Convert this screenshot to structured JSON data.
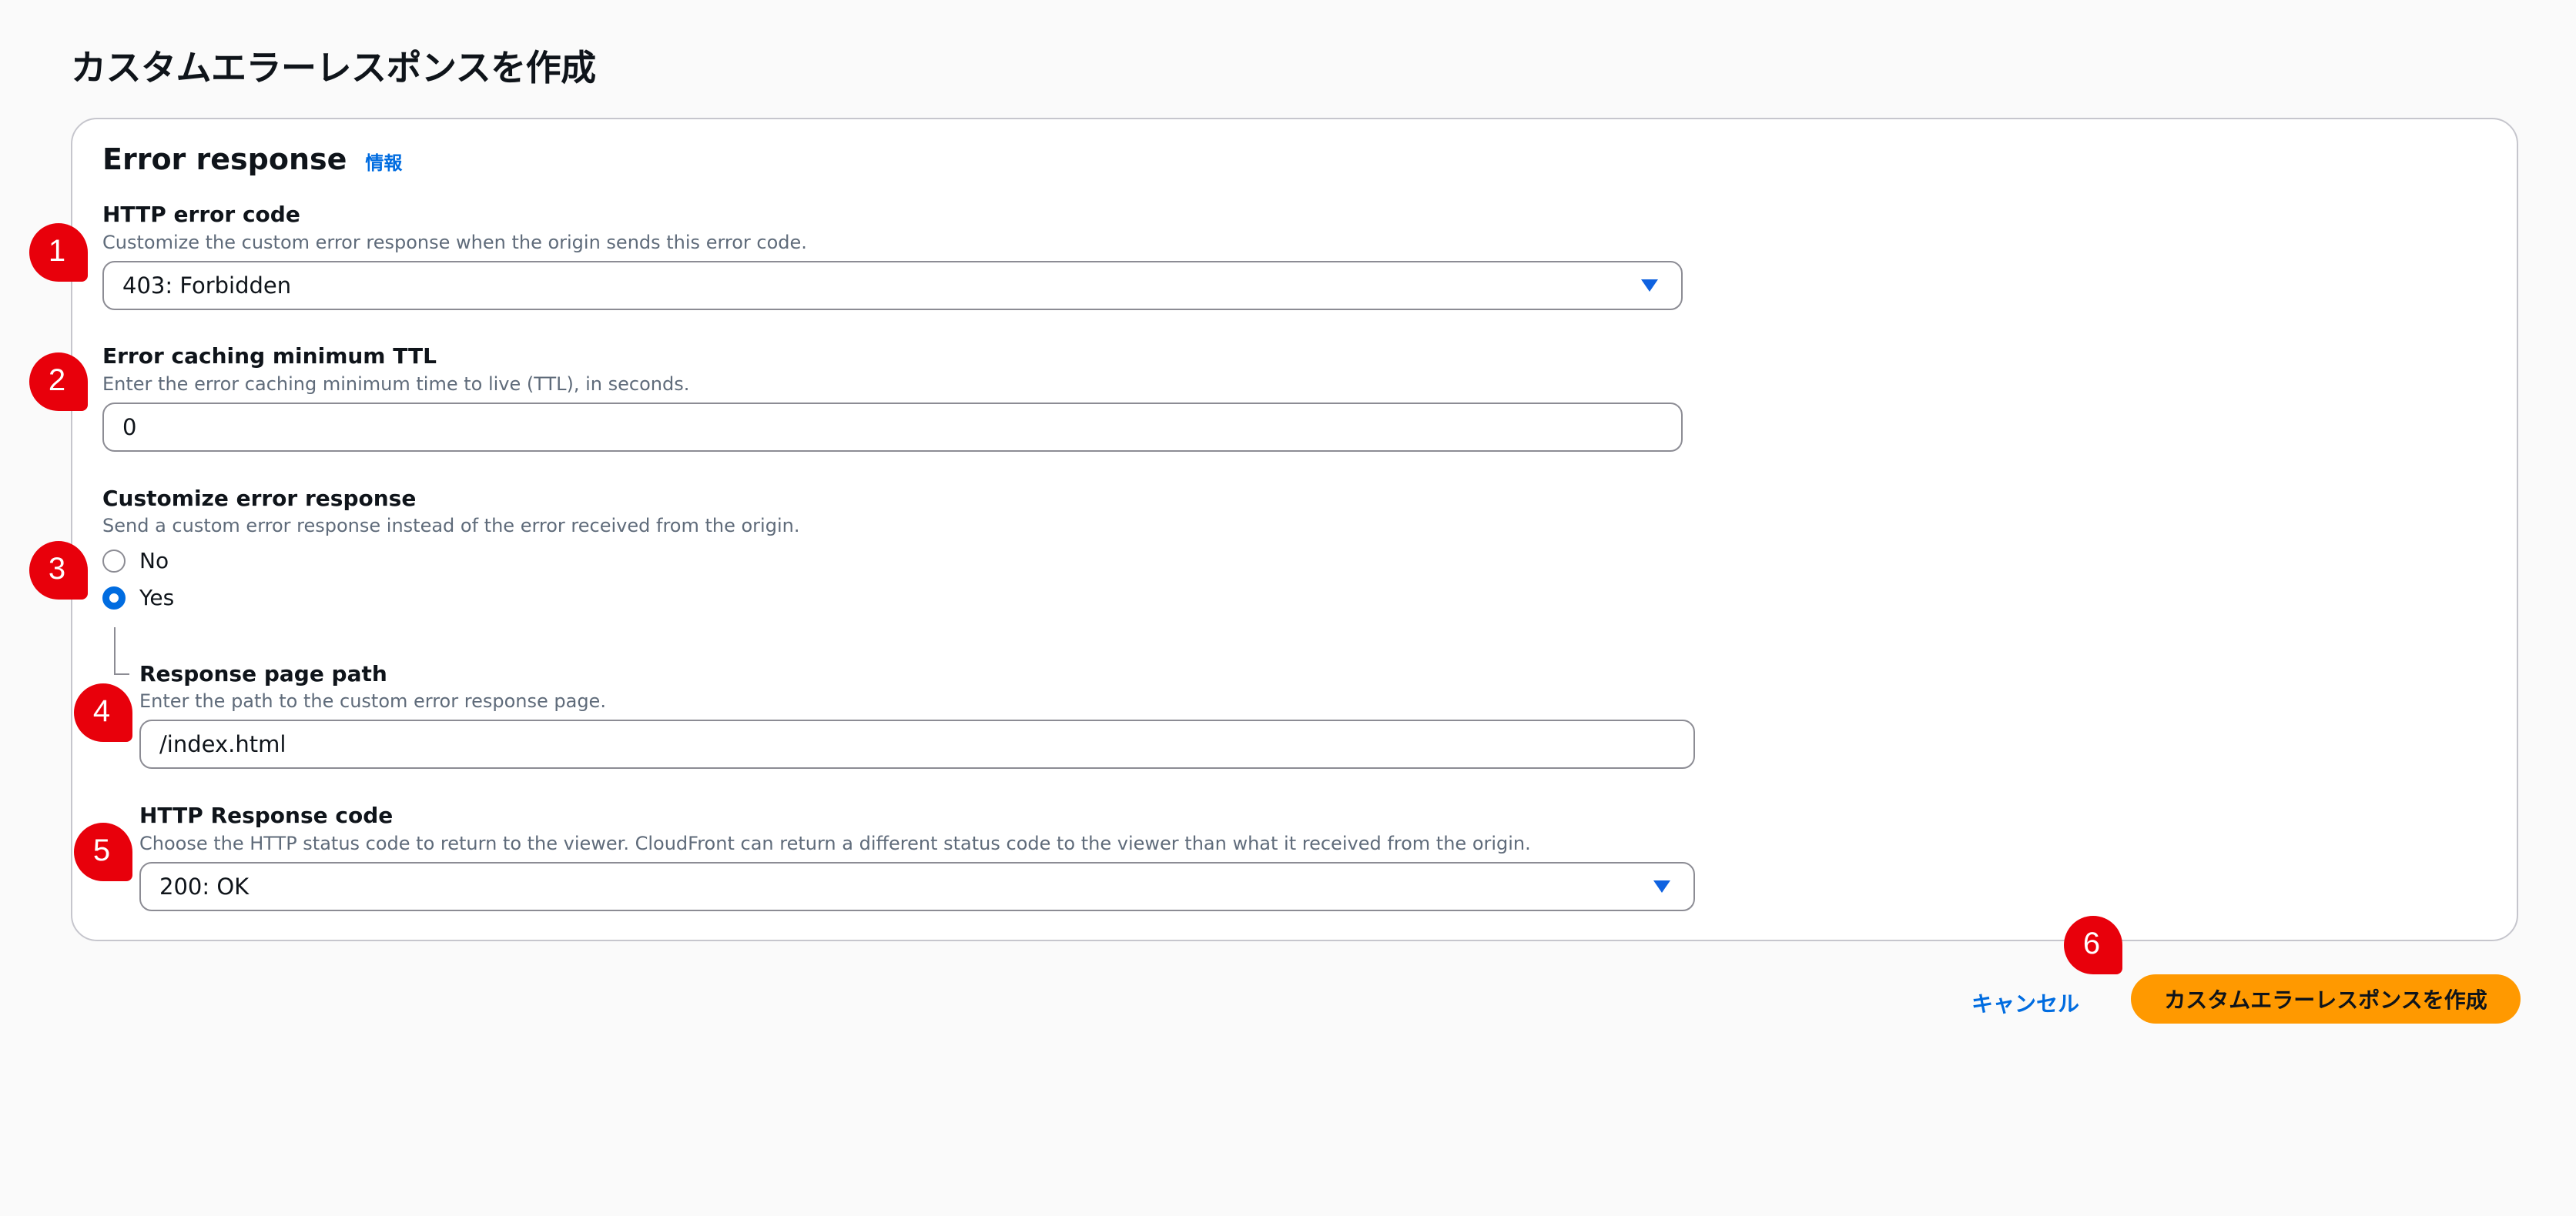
{
  "page": {
    "title": "カスタムエラーレスポンスを作成"
  },
  "panel": {
    "title": "Error response",
    "info_link": "情報"
  },
  "fields": {
    "http_error_code": {
      "label": "HTTP error code",
      "description": "Customize the custom error response when the origin sends this error code.",
      "value": "403: Forbidden"
    },
    "error_caching_ttl": {
      "label": "Error caching minimum TTL",
      "description": "Enter the error caching minimum time to live (TTL), in seconds.",
      "value": "0"
    },
    "customize_error_response": {
      "label": "Customize error response",
      "description": "Send a custom error response instead of the error received from the origin.",
      "options": [
        "No",
        "Yes"
      ],
      "selected": "Yes"
    },
    "response_page_path": {
      "label": "Response page path",
      "description": "Enter the path to the custom error response page.",
      "value": "/index.html"
    },
    "http_response_code": {
      "label": "HTTP Response code",
      "description": "Choose the HTTP status code to return to the viewer. CloudFront can return a different status code to the viewer than what it received from the origin.",
      "value": "200: OK"
    }
  },
  "actions": {
    "cancel_label": "キャンセル",
    "submit_label": "カスタムエラーレスポンスを作成"
  },
  "badges": [
    "1",
    "2",
    "3",
    "4",
    "5",
    "6"
  ],
  "colors": {
    "accent": "#006ce0",
    "primary_button": "#ff9900",
    "badge": "#e8000b"
  }
}
